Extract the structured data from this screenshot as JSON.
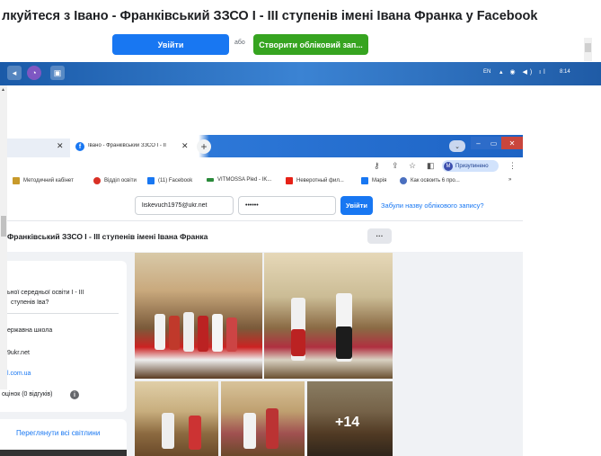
{
  "top_banner": {
    "title": "лкуйтеся з Івано - Франківський ЗЗСО І - ІІІ ступенів імені Івана Франка у Facebook",
    "login_label": "Увійти",
    "or_label": "або",
    "create_label": "Створити обліковий зап..."
  },
  "taskbar": {
    "language": "EN",
    "time": "8:14"
  },
  "browser": {
    "active_tab_title": "Івано - Франківський ЗЗСО І - ІІ",
    "profile_initial": "M",
    "profile_label": "Призупинено",
    "bookmarks": [
      {
        "label": "Методичний кабінет",
        "color": "#c89a2a"
      },
      {
        "label": "Відділ освіти",
        "color": "#d93025"
      },
      {
        "label": "(11) Facebook",
        "color": "#1877f2"
      },
      {
        "label": "VITMOSSA Pled - IK...",
        "color": "#2a8a3a"
      },
      {
        "label": "Неверотный фил...",
        "color": "#e62117"
      },
      {
        "label": "Марія",
        "color": "#1877f2"
      },
      {
        "label": "Как освоить 6 про...",
        "color": "#4a6fbf"
      }
    ]
  },
  "facebook": {
    "email_value": "liskevuch1975@ukr.net",
    "password_value": "••••••",
    "login_button": "Увійти",
    "forgot_link": "Забули назву облікового запису?",
    "page_name": "Франківський ЗЗСО І - ІІІ ступенів імені Івана Франка",
    "more_button": "···",
    "intro": {
      "line1": "ьної середньої освіти І - ІІІ",
      "line2": "ступенів Іва?",
      "line3": "ержавна школа",
      "line4": "9ukr.net",
      "line5": "l.com.ua",
      "line6": "оцінок (0 відгуків)"
    },
    "see_all_photos": "Переглянути всі світлини",
    "more_photos_count": "+14"
  }
}
